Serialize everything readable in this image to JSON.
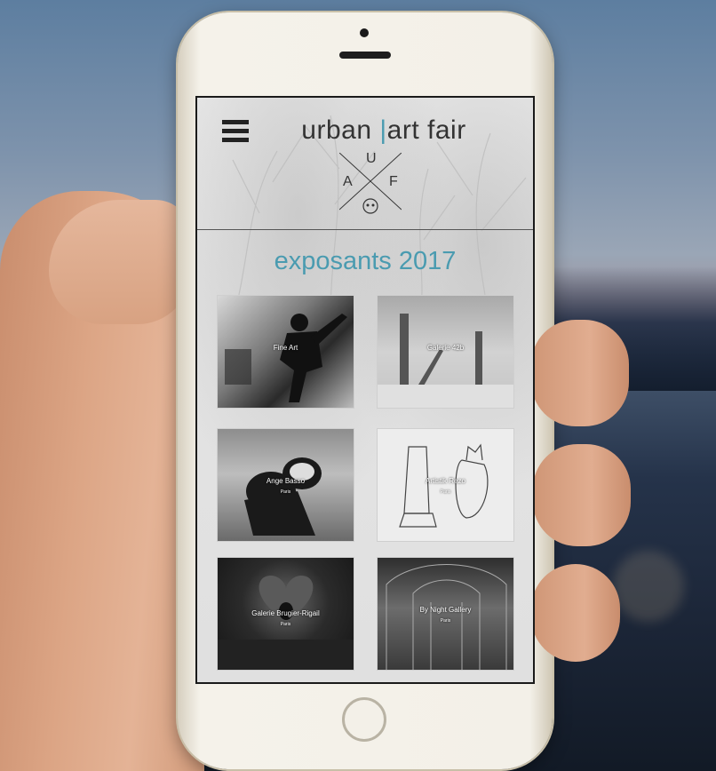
{
  "header": {
    "logo_left": "urban ",
    "logo_bar": "|",
    "logo_right": "art fair",
    "monogram": {
      "top": "U",
      "left": "A",
      "right": "F"
    }
  },
  "main": {
    "title": "exposants 2017",
    "exhibitors": [
      {
        "name": "Fine Art",
        "city": ""
      },
      {
        "name": "Galerie 42b",
        "city": ""
      },
      {
        "name": "Ange Basso",
        "city": "Paris"
      },
      {
        "name": "Artistik Rezo",
        "city": "Paris"
      },
      {
        "name": "Galerie Brugier-Rigail",
        "city": "Paris"
      },
      {
        "name": "By Night Gallery",
        "city": "Paris"
      }
    ]
  },
  "colors": {
    "accent": "#4a9bb0",
    "text": "#333333"
  }
}
